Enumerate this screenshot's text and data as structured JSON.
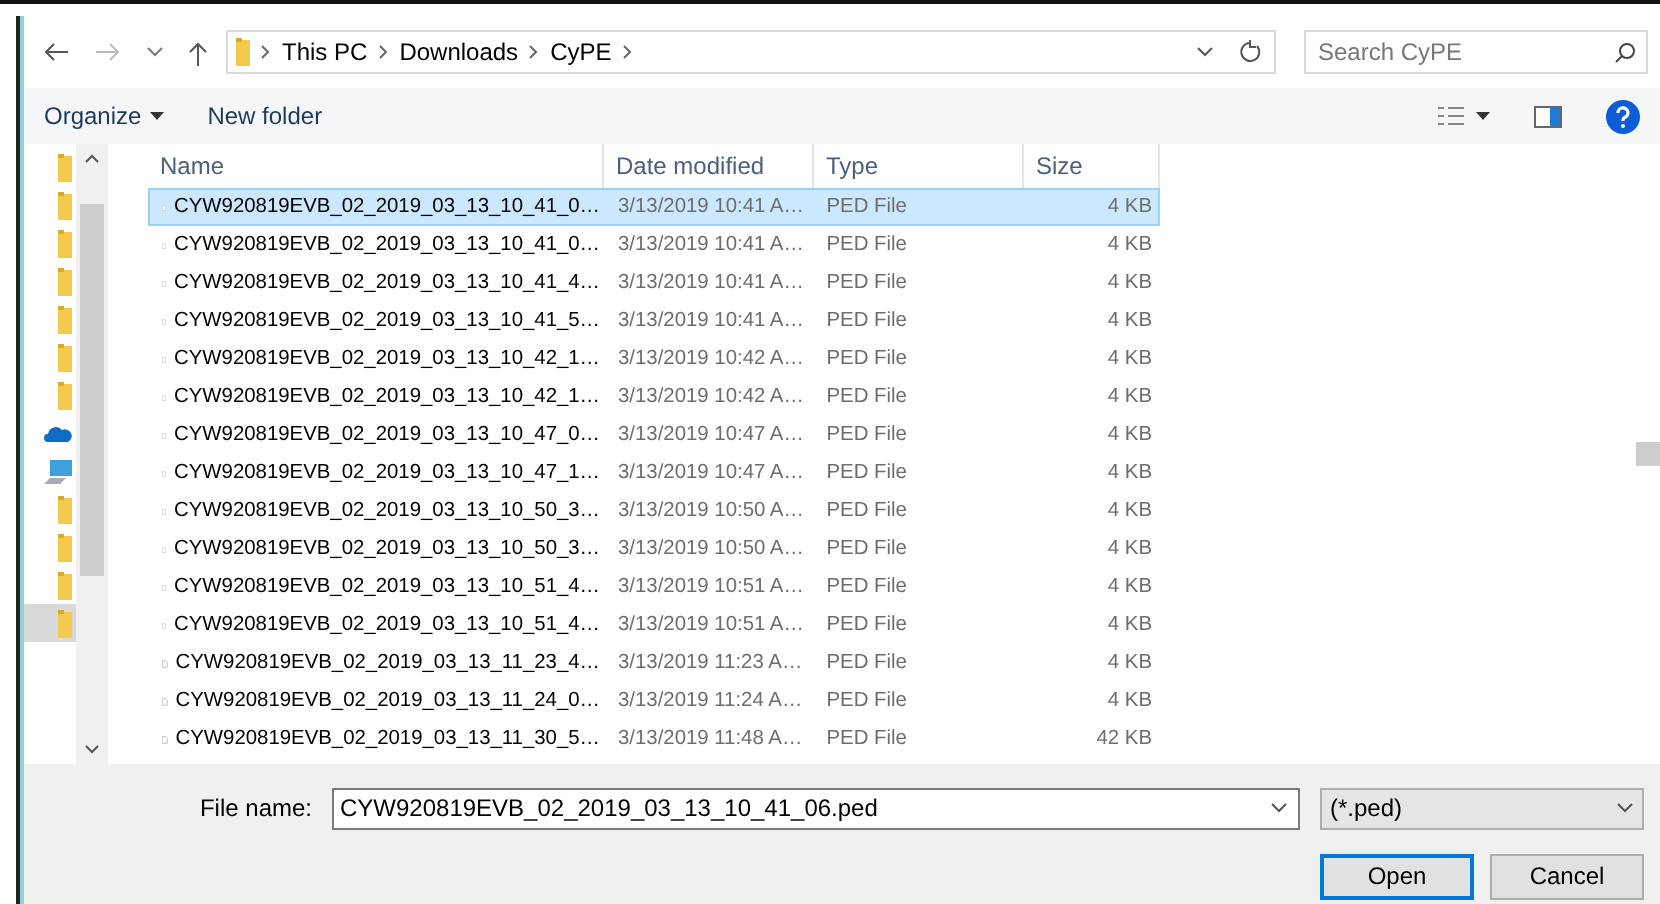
{
  "address": {
    "crumbs": [
      "This PC",
      "Downloads",
      "CyPE"
    ]
  },
  "search": {
    "placeholder": "Search CyPE"
  },
  "toolbar": {
    "organize": "Organize",
    "new_folder": "New folder"
  },
  "nav_pane": [
    {
      "kind": "folder",
      "selected": false
    },
    {
      "kind": "folder",
      "selected": false
    },
    {
      "kind": "folder",
      "selected": false
    },
    {
      "kind": "folder",
      "selected": false
    },
    {
      "kind": "folder",
      "selected": false
    },
    {
      "kind": "folder",
      "selected": false
    },
    {
      "kind": "folder",
      "selected": false
    },
    {
      "kind": "cloud",
      "selected": false
    },
    {
      "kind": "computer",
      "selected": false
    },
    {
      "kind": "folder",
      "selected": false
    },
    {
      "kind": "folder",
      "selected": false
    },
    {
      "kind": "folder",
      "selected": false
    },
    {
      "kind": "folder",
      "selected": true
    }
  ],
  "table": {
    "columns": [
      "Name",
      "Date modified",
      "Type",
      "Size"
    ],
    "rows": [
      {
        "name": "CYW920819EVB_02_2019_03_13_10_41_0…",
        "date": "3/13/2019 10:41 A…",
        "type": "PED File",
        "size": "4 KB",
        "selected": true
      },
      {
        "name": "CYW920819EVB_02_2019_03_13_10_41_0…",
        "date": "3/13/2019 10:41 A…",
        "type": "PED File",
        "size": "4 KB",
        "selected": false
      },
      {
        "name": "CYW920819EVB_02_2019_03_13_10_41_4…",
        "date": "3/13/2019 10:41 A…",
        "type": "PED File",
        "size": "4 KB",
        "selected": false
      },
      {
        "name": "CYW920819EVB_02_2019_03_13_10_41_5…",
        "date": "3/13/2019 10:41 A…",
        "type": "PED File",
        "size": "4 KB",
        "selected": false
      },
      {
        "name": "CYW920819EVB_02_2019_03_13_10_42_1…",
        "date": "3/13/2019 10:42 A…",
        "type": "PED File",
        "size": "4 KB",
        "selected": false
      },
      {
        "name": "CYW920819EVB_02_2019_03_13_10_42_1…",
        "date": "3/13/2019 10:42 A…",
        "type": "PED File",
        "size": "4 KB",
        "selected": false
      },
      {
        "name": "CYW920819EVB_02_2019_03_13_10_47_0…",
        "date": "3/13/2019 10:47 A…",
        "type": "PED File",
        "size": "4 KB",
        "selected": false
      },
      {
        "name": "CYW920819EVB_02_2019_03_13_10_47_1…",
        "date": "3/13/2019 10:47 A…",
        "type": "PED File",
        "size": "4 KB",
        "selected": false
      },
      {
        "name": "CYW920819EVB_02_2019_03_13_10_50_3…",
        "date": "3/13/2019 10:50 A…",
        "type": "PED File",
        "size": "4 KB",
        "selected": false
      },
      {
        "name": "CYW920819EVB_02_2019_03_13_10_50_3…",
        "date": "3/13/2019 10:50 A…",
        "type": "PED File",
        "size": "4 KB",
        "selected": false
      },
      {
        "name": "CYW920819EVB_02_2019_03_13_10_51_4…",
        "date": "3/13/2019 10:51 A…",
        "type": "PED File",
        "size": "4 KB",
        "selected": false
      },
      {
        "name": "CYW920819EVB_02_2019_03_13_10_51_4…",
        "date": "3/13/2019 10:51 A…",
        "type": "PED File",
        "size": "4 KB",
        "selected": false
      },
      {
        "name": "CYW920819EVB_02_2019_03_13_11_23_4…",
        "date": "3/13/2019 11:23 A…",
        "type": "PED File",
        "size": "4 KB",
        "selected": false
      },
      {
        "name": "CYW920819EVB_02_2019_03_13_11_24_0…",
        "date": "3/13/2019 11:24 A…",
        "type": "PED File",
        "size": "4 KB",
        "selected": false
      },
      {
        "name": "CYW920819EVB_02_2019_03_13_11_30_5…",
        "date": "3/13/2019 11:48 A…",
        "type": "PED File",
        "size": "42 KB",
        "selected": false
      }
    ]
  },
  "footer": {
    "file_name_label": "File name:",
    "file_name": "CYW920819EVB_02_2019_03_13_10_41_06.ped",
    "filter": "(*.ped)",
    "open": "Open",
    "cancel": "Cancel"
  }
}
